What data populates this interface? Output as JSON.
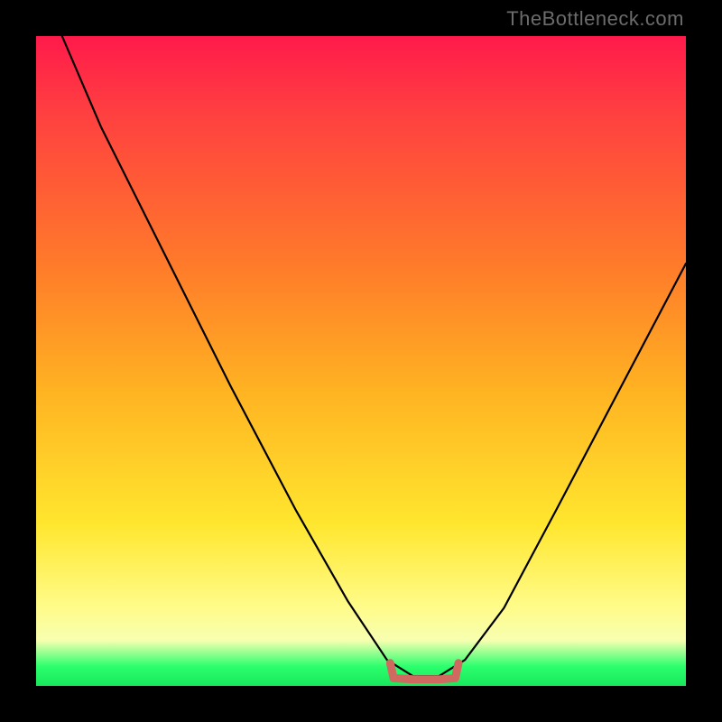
{
  "watermark": "TheBottleneck.com",
  "colors": {
    "frame": "#000000",
    "gradient_top": "#ff1a4b",
    "gradient_mid1": "#ff7a2a",
    "gradient_mid2": "#ffe62e",
    "gradient_bottom_band": "#f7ffb0",
    "gradient_bottom": "#18e85c",
    "curve": "#000000",
    "bottom_bracket": "#d06a60"
  },
  "chart_data": {
    "type": "line",
    "title": "",
    "xlabel": "",
    "ylabel": "",
    "xlim": [
      0,
      1
    ],
    "ylim": [
      0,
      1
    ],
    "note": "Axes are unlabeled; x and y are normalized to the plot box. y=1 is top (red), y=0 is bottom (green). Curve is a V / valley shape with minimum around x≈0.56–0.64 touching the green band; a small reddish bracket marks that bottom segment.",
    "series": [
      {
        "name": "bottleneck-curve",
        "x": [
          0.04,
          0.1,
          0.2,
          0.3,
          0.4,
          0.48,
          0.54,
          0.58,
          0.6,
          0.62,
          0.66,
          0.72,
          0.8,
          0.9,
          1.0
        ],
        "y": [
          1.0,
          0.86,
          0.66,
          0.46,
          0.27,
          0.13,
          0.04,
          0.015,
          0.015,
          0.015,
          0.04,
          0.12,
          0.27,
          0.46,
          0.65
        ]
      },
      {
        "name": "bottom-bracket",
        "x": [
          0.545,
          0.55,
          0.58,
          0.6,
          0.62,
          0.645,
          0.65
        ],
        "y": [
          0.035,
          0.012,
          0.01,
          0.01,
          0.01,
          0.012,
          0.035
        ]
      }
    ]
  }
}
